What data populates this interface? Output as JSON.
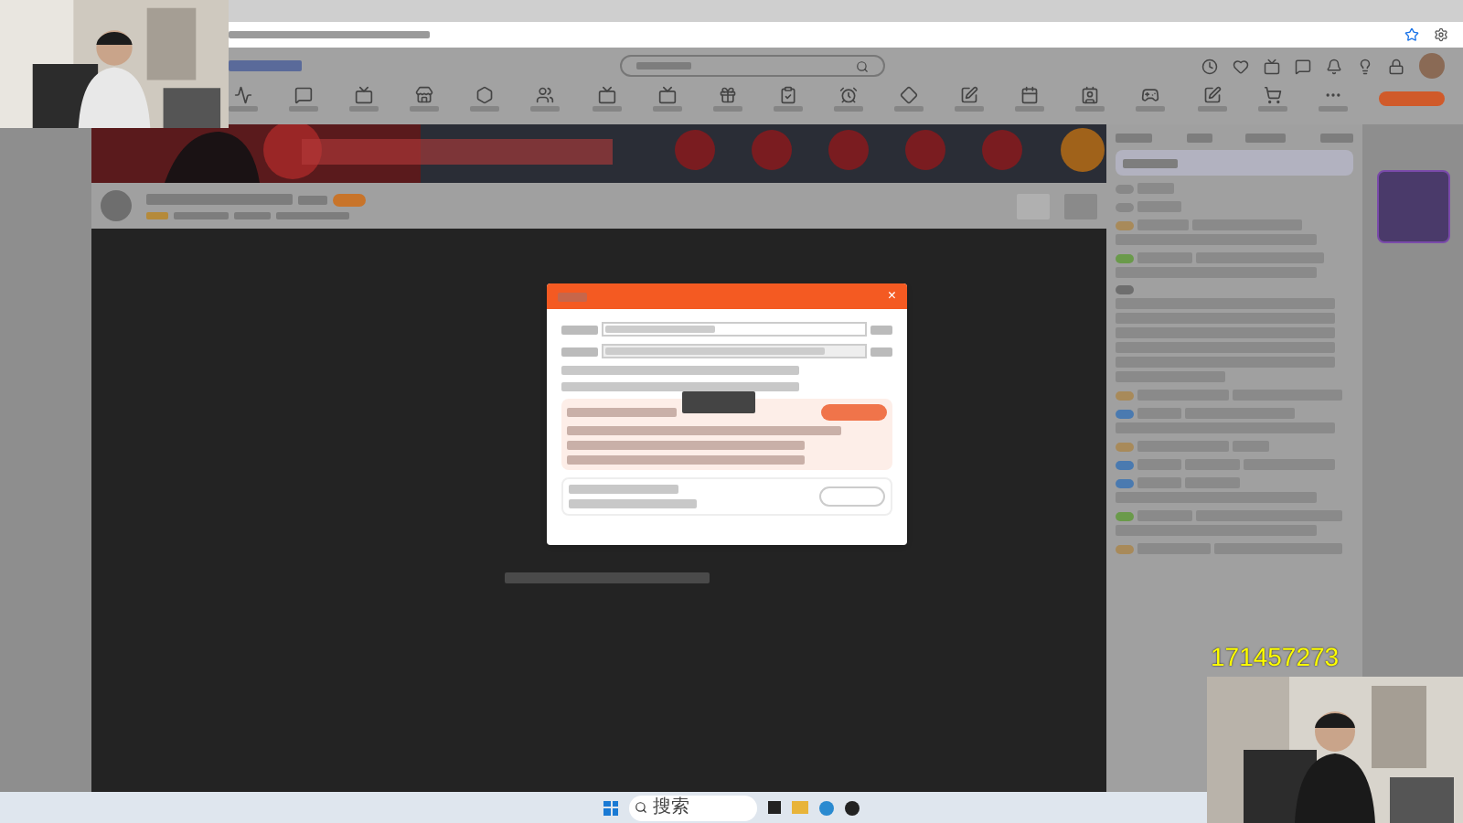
{
  "dialog": {
    "close": "×"
  },
  "stream_overlay": {
    "number": "171457273"
  },
  "taskbar": {
    "search": {
      "placeholder": "搜索"
    }
  }
}
